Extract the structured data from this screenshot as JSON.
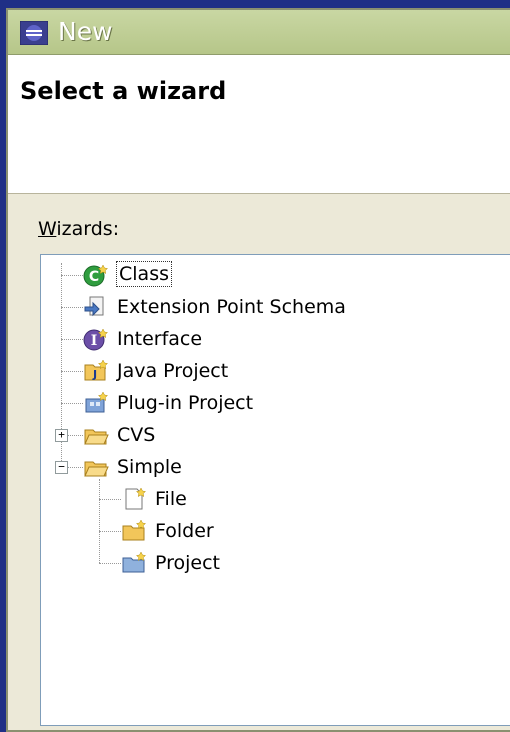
{
  "window": {
    "title": "New",
    "icon": "eclipse-app-icon"
  },
  "header": {
    "title": "Select a wizard"
  },
  "wizards_label": {
    "underlined": "W",
    "rest": "izards:"
  },
  "tree": {
    "items": [
      {
        "label": "Class",
        "icon": "class-icon",
        "selected": true
      },
      {
        "label": "Extension Point Schema",
        "icon": "extension-point-schema-icon"
      },
      {
        "label": "Interface",
        "icon": "interface-icon"
      },
      {
        "label": "Java Project",
        "icon": "java-project-icon"
      },
      {
        "label": "Plug-in Project",
        "icon": "plugin-project-icon"
      },
      {
        "label": "CVS",
        "icon": "folder-icon",
        "expander": "+"
      },
      {
        "label": "Simple",
        "icon": "open-folder-icon",
        "expander": "−"
      },
      {
        "label": "File",
        "icon": "new-file-icon"
      },
      {
        "label": "Folder",
        "icon": "new-folder-icon"
      },
      {
        "label": "Project",
        "icon": "new-project-icon"
      }
    ]
  }
}
